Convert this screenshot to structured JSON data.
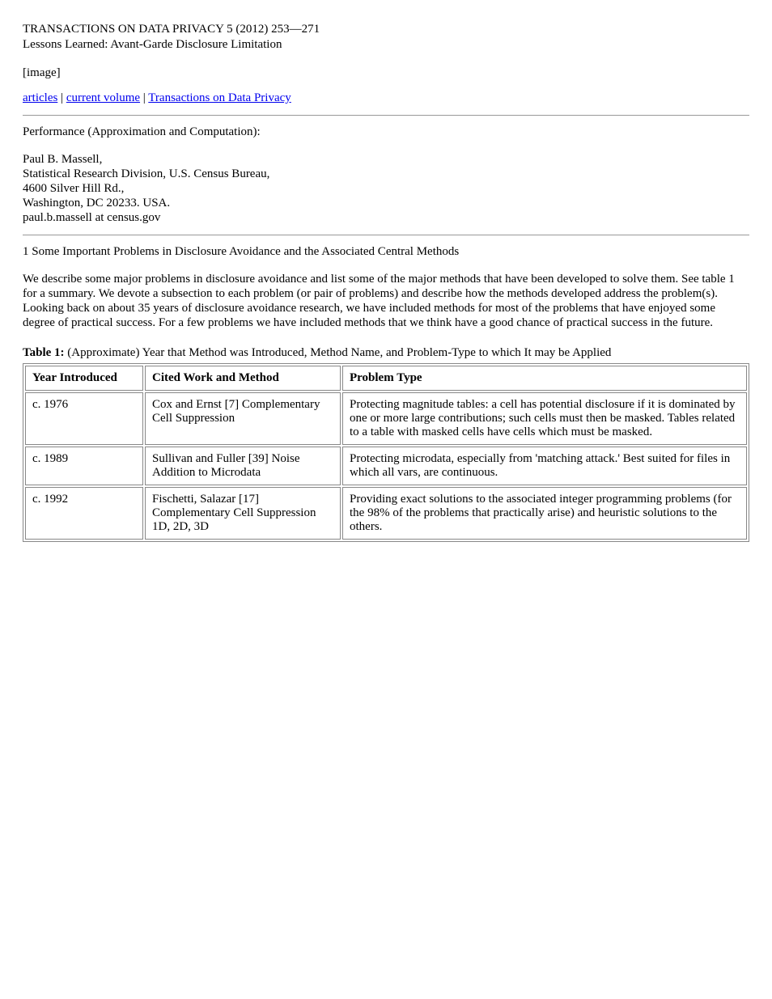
{
  "header": {
    "journal_title": "TRANSACTIONS ON DATA PRIVACY 5 (2012) 253—271",
    "subtitle": "Lessons Learned: Avant-Garde Disclosure Limitation",
    "image_note": "[image]"
  },
  "breadcrumb": {
    "items": [
      {
        "text": "articles",
        "href": true
      },
      {
        "text": "current volume",
        "href": true
      },
      {
        "text": "Transactions on Data Privacy",
        "href": true
      }
    ],
    "separator": " | "
  },
  "performance": {
    "title": "Performance (Approximation and Computation):",
    "lines": [
      "Paul B. Massell,",
      "Statistical Research Division, U.S. Census Bureau,",
      "4600 Silver Hill Rd.,",
      "Washington, DC 20233. USA.",
      "paul.b.massell at census.gov"
    ]
  },
  "section": {
    "heading": "1 Some Important Problems in Disclosure Avoidance and the Associated Central Methods",
    "intro": "We describe some major problems in disclosure avoidance and list some of the major methods that have been developed to solve them. See table 1 for a summary. We devote a subsection to each problem (or pair of problems) and describe how the methods developed address the problem(s). Looking back on about 35 years of disclosure avoidance research, we have included methods for most of the problems that have enjoyed some degree of practical success. For a few problems we have included methods that we think have a good chance of practical success in the future."
  },
  "table": {
    "caption_label": "Table 1:",
    "caption_text": "(Approximate) Year that Method was Introduced, Method Name, and Problem-Type to which It may be Applied",
    "headers": [
      "Year Introduced",
      "Cited Work and Method",
      "Problem Type"
    ],
    "rows": [
      {
        "year": "c. 1976",
        "work": "Cox and Ernst [7] Complementary Cell Suppression",
        "desc": "Protecting magnitude tables: a cell has potential disclosure if it is dominated by one or more large contributions; such cells must then be masked. Tables related to a table with masked cells have cells which must be masked."
      },
      {
        "year": "c. 1989",
        "work": "Sullivan and Fuller [39] Noise Addition to Microdata",
        "desc": "Protecting microdata, especially from 'matching attack.' Best suited for files in which all vars, are continuous."
      },
      {
        "year": "c. 1992",
        "work": "Fischetti, Salazar [17] Complementary Cell Suppression 1D, 2D, 3D",
        "desc": "Providing exact solutions to the associated integer programming problems (for the 98% of the problems that practically arise) and heuristic solutions to the others."
      }
    ]
  }
}
